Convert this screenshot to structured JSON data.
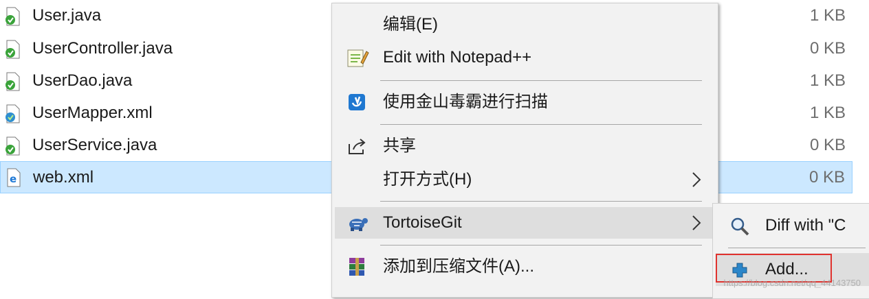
{
  "files": [
    {
      "name": "User.java",
      "size": "1 KB",
      "icon": "java-file-icon"
    },
    {
      "name": "UserController.java",
      "size": "0 KB",
      "icon": "java-file-icon"
    },
    {
      "name": "UserDao.java",
      "size": "1 KB",
      "icon": "java-file-icon"
    },
    {
      "name": "UserMapper.xml",
      "size": "1 KB",
      "icon": "xml-file-icon"
    },
    {
      "name": "UserService.java",
      "size": "0 KB",
      "icon": "java-file-icon"
    },
    {
      "name": "web.xml",
      "size": "0 KB",
      "icon": "web-xml-file-icon",
      "selected": true
    }
  ],
  "context_menu": {
    "items": [
      {
        "label": "编辑(E)",
        "icon": ""
      },
      {
        "label": "Edit with Notepad++",
        "icon": "notepad-plus-plus-icon"
      },
      {
        "label": "使用金山毒霸进行扫描",
        "icon": "kingsoft-antivirus-icon"
      },
      {
        "label": "共享",
        "icon": "share-icon"
      },
      {
        "label": "打开方式(H)",
        "icon": "",
        "submenu": true
      },
      {
        "label": "TortoiseGit",
        "icon": "tortoisegit-icon",
        "submenu": true,
        "highlighted": true
      },
      {
        "label": "添加到压缩文件(A)...",
        "icon": "winrar-icon"
      }
    ]
  },
  "tortoisegit_submenu": {
    "items": [
      {
        "label": "Diff with \"C",
        "icon": "diff-magnifier-icon"
      },
      {
        "label": "Add...",
        "icon": "add-icon",
        "highlighted": true
      }
    ]
  },
  "watermark": "https://blog.csdn.net/qq_44143750",
  "colors": {
    "selection_bg": "#cce8ff",
    "menu_bg": "#f2f2f2",
    "menu_highlight": "#dedede",
    "annotation_red": "#e0322e"
  }
}
